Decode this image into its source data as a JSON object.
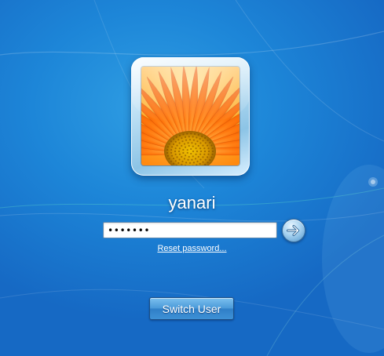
{
  "user": {
    "name": "yanari",
    "avatar": "orange-gerbera-flower"
  },
  "login": {
    "password_value": "•••••••",
    "submit_icon": "right-arrow-icon",
    "reset_link_label": "Reset password..."
  },
  "footer": {
    "switch_user_label": "Switch User"
  },
  "colors": {
    "background": "#1d86d8",
    "background_dark": "#1669c4",
    "text": "#ffffff",
    "flower_petal": "#ff7a10",
    "flower_center": "#e0a000"
  }
}
